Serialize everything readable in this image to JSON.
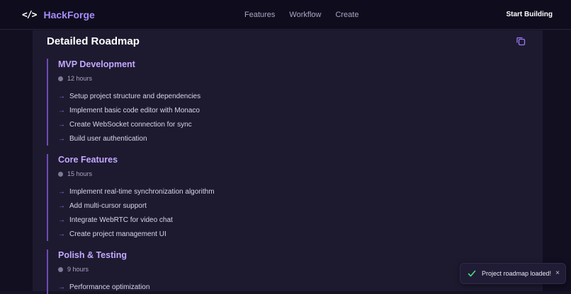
{
  "nav": {
    "brand_icon": "</>",
    "brand_name": "HackForge",
    "links": [
      "Features",
      "Workflow",
      "Create"
    ],
    "cta": "Start Building"
  },
  "roadmap": {
    "title": "Detailed Roadmap",
    "copy_icon": "copy-icon",
    "phases": [
      {
        "title": "MVP Development",
        "duration": "12 hours",
        "tasks": [
          "Setup project structure and dependencies",
          "Implement basic code editor with Monaco",
          "Create WebSocket connection for sync",
          "Build user authentication"
        ]
      },
      {
        "title": "Core Features",
        "duration": "15 hours",
        "tasks": [
          "Implement real-time synchronization algorithm",
          "Add multi-cursor support",
          "Integrate WebRTC for video chat",
          "Create project management UI"
        ]
      },
      {
        "title": "Polish & Testing",
        "duration": "9 hours",
        "tasks": [
          "Performance optimization"
        ]
      }
    ]
  },
  "toast": {
    "message": "Project roadmap loaded!",
    "close": "×"
  },
  "colors": {
    "accent": "#a78bfa",
    "phase_title": "#c4a8ff",
    "arrow": "#8b6fe0",
    "success": "#4ade80"
  }
}
